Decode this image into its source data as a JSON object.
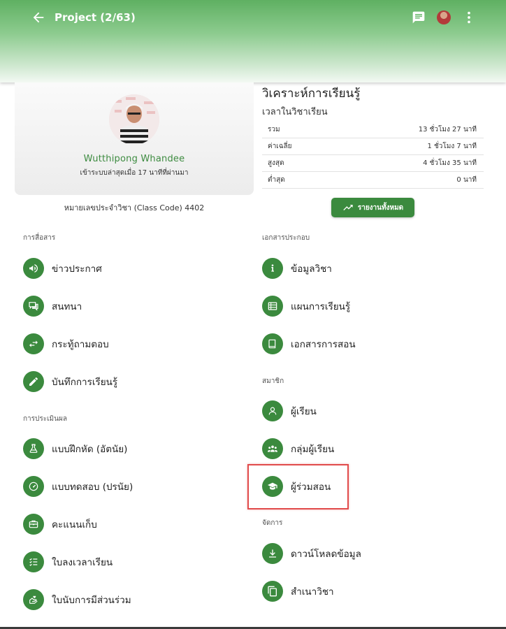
{
  "header": {
    "title": "Project (2/63)",
    "icons": [
      "back-arrow-icon",
      "chat-icon",
      "user-avatar",
      "more-vert-icon"
    ]
  },
  "profile": {
    "name": "Wutthipong Whandee",
    "last_login": "เข้าระบบล่าสุดเมื่อ 17 นาทีที่ผ่านมา",
    "class_code": "หมายเลขประจำวิชา (Class Code) 4402"
  },
  "analytics": {
    "title": "วิเคราะห์การเรียนรู้",
    "subtitle": "เวลาในวิชาเรียน",
    "rows": [
      {
        "label": "รวม",
        "value": "13 ชั่วโมง 27 นาที"
      },
      {
        "label": "ค่าเฉลี่ย",
        "value": "1 ชั่วโมง 7 นาที"
      },
      {
        "label": "สูงสุด",
        "value": "4 ชั่วโมง 35 นาที"
      },
      {
        "label": "ต่ำสุด",
        "value": "0 นาที"
      }
    ],
    "report_button": "รายงานทั้งหมด"
  },
  "colors": {
    "primary": "#3b8a3e",
    "name_text": "#3d8b40",
    "highlight": "#e14b4b"
  },
  "sections": {
    "communication": {
      "label": "การสื่อสาร",
      "items": [
        {
          "label": "ข่าวประกาศ",
          "icon": "megaphone-icon"
        },
        {
          "label": "สนทนา",
          "icon": "chat-bubbles-icon"
        },
        {
          "label": "กระทู้ถามตอบ",
          "icon": "swap-arrows-icon"
        },
        {
          "label": "บันทึกการเรียนรู้",
          "icon": "pencil-icon"
        }
      ]
    },
    "assessment": {
      "label": "การประเมินผล",
      "items": [
        {
          "label": "แบบฝึกหัด (อัตนัย)",
          "icon": "flask-icon"
        },
        {
          "label": "แบบทดสอบ (ปรนัย)",
          "icon": "gauge-icon"
        },
        {
          "label": "คะแนนเก็บ",
          "icon": "briefcase-icon"
        },
        {
          "label": "ใบลงเวลาเรียน",
          "icon": "checklist-icon"
        },
        {
          "label": "ใบนับการมีส่วนร่วม",
          "icon": "hand-heart-icon"
        }
      ]
    },
    "documents": {
      "label": "เอกสารประกอบ",
      "items": [
        {
          "label": "ข้อมูลวิชา",
          "icon": "info-icon"
        },
        {
          "label": "แผนการเรียนรู้",
          "icon": "table-list-icon"
        },
        {
          "label": "เอกสารการสอน",
          "icon": "book-icon"
        }
      ]
    },
    "members": {
      "label": "สมาชิก",
      "items": [
        {
          "label": "ผู้เรียน",
          "icon": "user-icon"
        },
        {
          "label": "กลุ่มผู้เรียน",
          "icon": "users-group-icon"
        },
        {
          "label": "ผู้ร่วมสอน",
          "icon": "graduation-cap-icon"
        }
      ]
    },
    "manage": {
      "label": "จัดการ",
      "items": [
        {
          "label": "ดาวน์โหลดข้อมูล",
          "icon": "download-icon"
        },
        {
          "label": "สำเนาวิชา",
          "icon": "copy-icon"
        }
      ]
    }
  }
}
